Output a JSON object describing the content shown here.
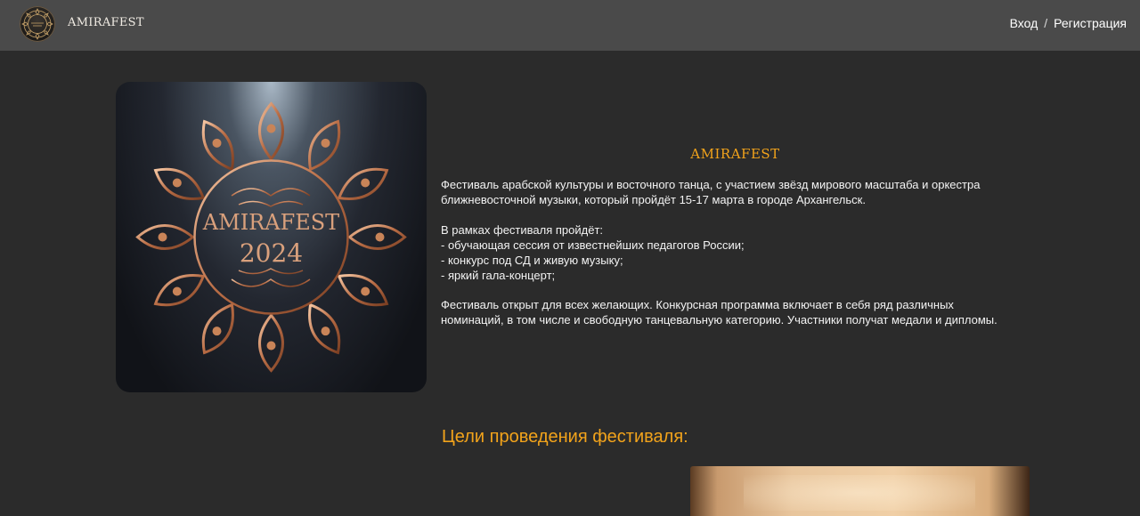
{
  "header": {
    "brand": "AMIRAFEST",
    "login": "Вход",
    "separator": "/",
    "register": "Регистрация"
  },
  "poster": {
    "title_line1": "AMIRAFEST",
    "title_line2": "2024"
  },
  "about": {
    "title": "AMIRAFEST",
    "intro_lines": [
      "Фестиваль арабской культуры и восточного танца, с участием звёзд мирового масштаба и оркестра",
      "ближневосточной музыки, который пройдёт 15-17 марта в городе Архангельск."
    ],
    "program_lines": [
      "В рамках фестиваля пройдёт:",
      "- обучающая сессия от известнейших педагогов России;",
      "- конкурс под СД и живую музыку;",
      "- яркий гала-концерт;"
    ],
    "open_lines": [
      "Фестиваль открыт для всех желающих. Конкурсная программа включает в себя ряд различных",
      "номинаций, в том числе и свободную танцевальную категорию. Участники получат медали и дипломы."
    ]
  },
  "goals": {
    "title": "Цели проведения фестиваля:"
  },
  "colors": {
    "accent": "#f2a31b",
    "header_bg": "#4a4a4a",
    "page_bg": "#2b2b2b",
    "text": "#f3f3f3"
  }
}
